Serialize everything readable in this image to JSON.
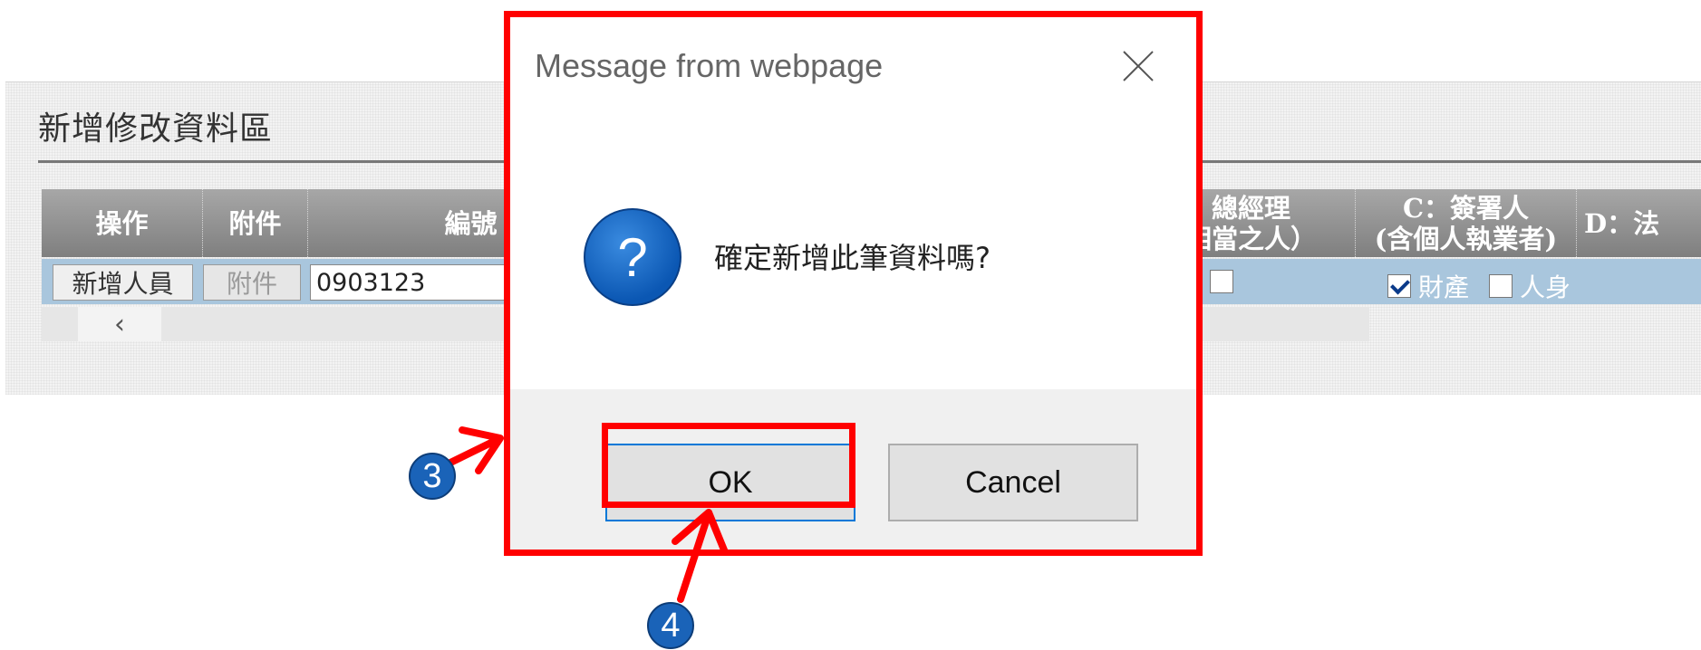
{
  "panel": {
    "title": "新增修改資料區",
    "columns": [
      {
        "label": "操作"
      },
      {
        "label": "附件"
      },
      {
        "label": "編號"
      },
      {
        "label": "總經理\n相當之人）"
      },
      {
        "label": "C：簽署人\n(含個人執業者)"
      },
      {
        "label": "D：法"
      }
    ],
    "row": {
      "action_button": "新增人員",
      "attachment_button": "附件",
      "id_value": "0903123",
      "c_signer_options": [
        {
          "label": "財產",
          "checked": true
        },
        {
          "label": "人身",
          "checked": false
        }
      ]
    },
    "scroll_left_glyph": "‹"
  },
  "dialog": {
    "title": "Message from webpage",
    "message": "確定新增此筆資料嗎?",
    "icon": "question-icon",
    "ok_label": "OK",
    "cancel_label": "Cancel"
  },
  "annotations": {
    "step_dialog": "3",
    "step_ok": "4",
    "highlight_color": "#ff0000",
    "badge_color": "#1a63b8"
  }
}
